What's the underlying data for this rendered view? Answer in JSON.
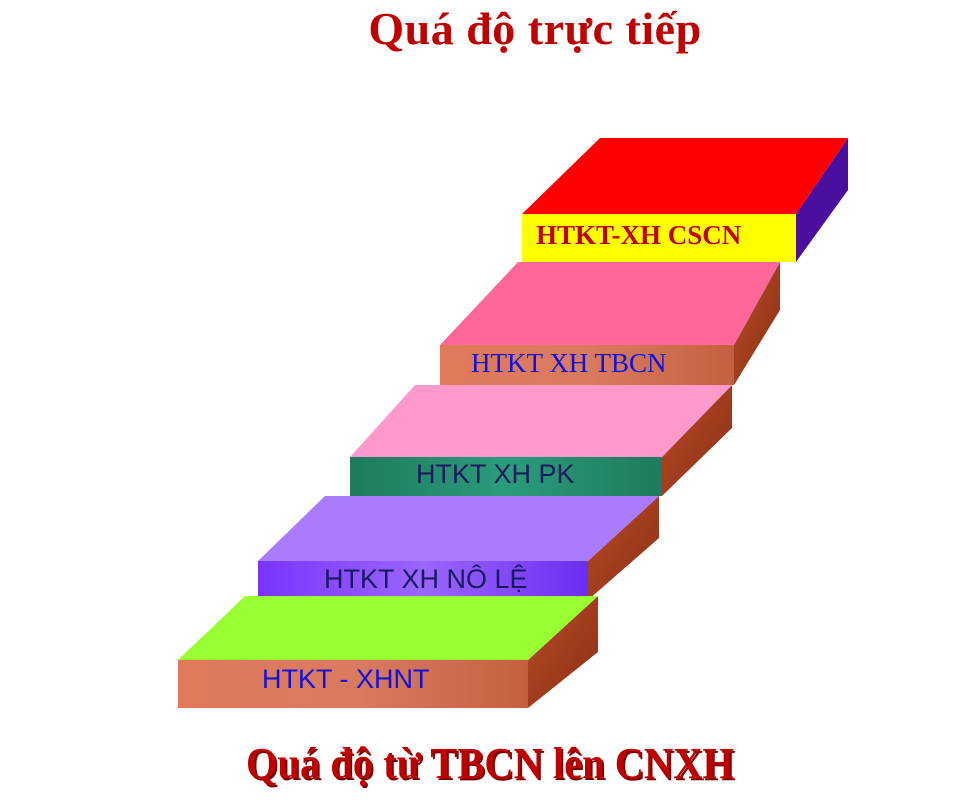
{
  "title": "Quá độ trực tiếp",
  "caption": "Quá độ từ TBCN lên CNXH",
  "steps": [
    {
      "label": "HTKT - XHNT",
      "top_color": "#99ff33",
      "front_color": "#d9765c",
      "text_color": "#1010e0"
    },
    {
      "label": "HTKT XH NÔ LỆ",
      "top_color": "#aa7bff",
      "front_color": "#8844ff",
      "text_color": "#1a1a5e"
    },
    {
      "label": "HTKT XH PK",
      "top_color": "#ff99cc",
      "front_color": "#1f8a6e",
      "text_color": "#1a1a5e"
    },
    {
      "label": "HTKT XH TBCN",
      "top_color": "#ff6699",
      "front_color": "#d9765c",
      "text_color": "#1010e0"
    },
    {
      "label": "HTKT-XH CSCN",
      "top_color": "#ff0000",
      "front_color": "#ffff00",
      "text_color": "#c00000"
    }
  ],
  "side_colors": {
    "brown": "#a33f1f",
    "purple": "#4b0fa0"
  }
}
